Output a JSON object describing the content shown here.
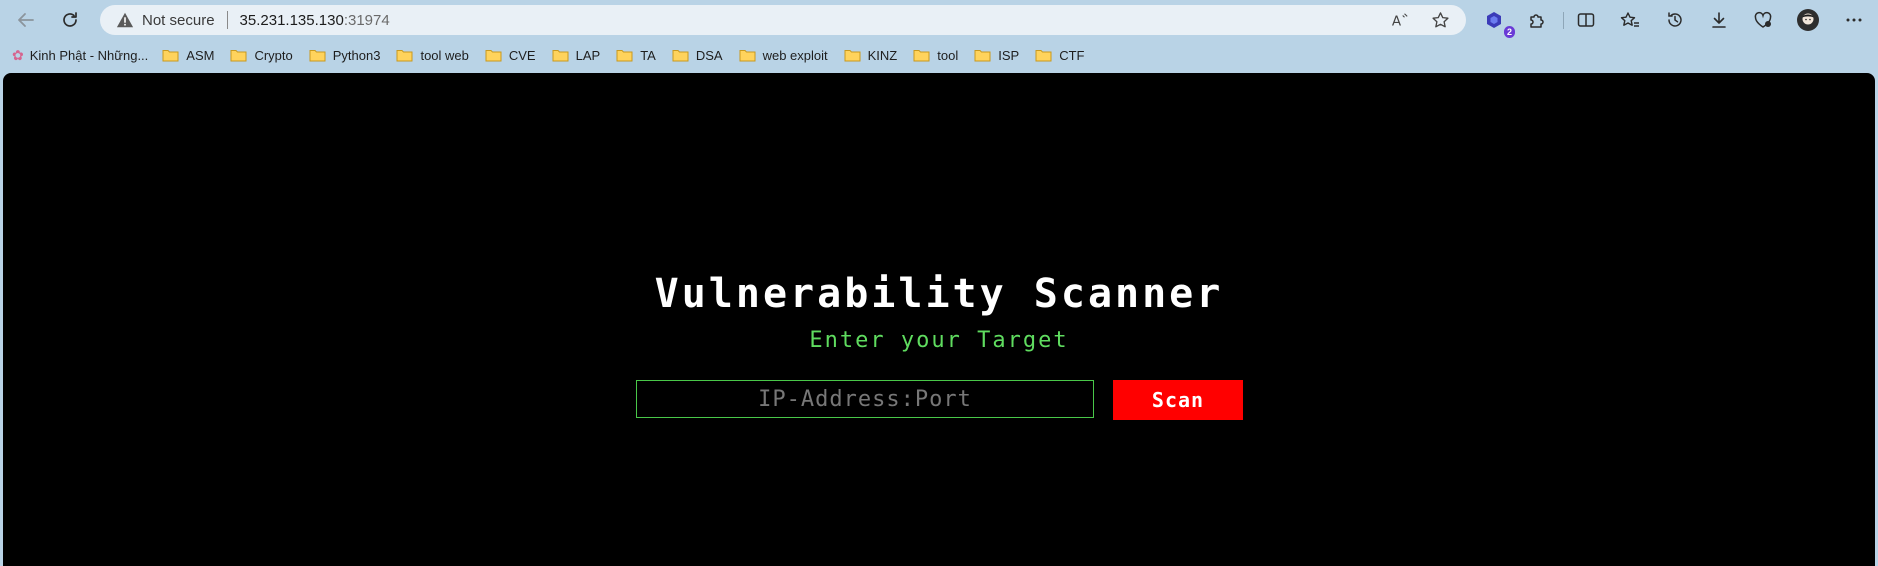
{
  "browser": {
    "security_label": "Not secure",
    "url_host": "35.231.135.130",
    "url_port": ":31974",
    "extension_badge": "2",
    "icons": {
      "back": "back-arrow-icon",
      "reload": "reload-icon",
      "warning": "warning-triangle-icon",
      "read_aloud": "read-aloud-icon",
      "favorite": "star-icon",
      "extensions": "puzzle-icon",
      "split_screen": "split-screen-icon",
      "favorites": "favorites-icon",
      "history": "history-icon",
      "downloads": "download-icon",
      "health": "heart-icon",
      "profile": "avatar-icon",
      "menu": "ellipsis-icon"
    }
  },
  "bookmarks": [
    "Kinh Phật - Những...",
    "ASM",
    "Crypto",
    "Python3",
    "tool web",
    "CVE",
    "LAP",
    "TA",
    "DSA",
    "web exploit",
    "KINZ",
    "tool",
    "ISP",
    "CTF"
  ],
  "page": {
    "title": "Vulnerability Scanner",
    "subtitle": "Enter your Target",
    "input_placeholder": "IP-Address:Port",
    "input_value": "",
    "scan_label": "Scan",
    "colors": {
      "background": "#000000",
      "title": "#ffffff",
      "subtitle": "#5fdc5f",
      "input_border": "#49c749",
      "button": "#ff0000"
    }
  }
}
